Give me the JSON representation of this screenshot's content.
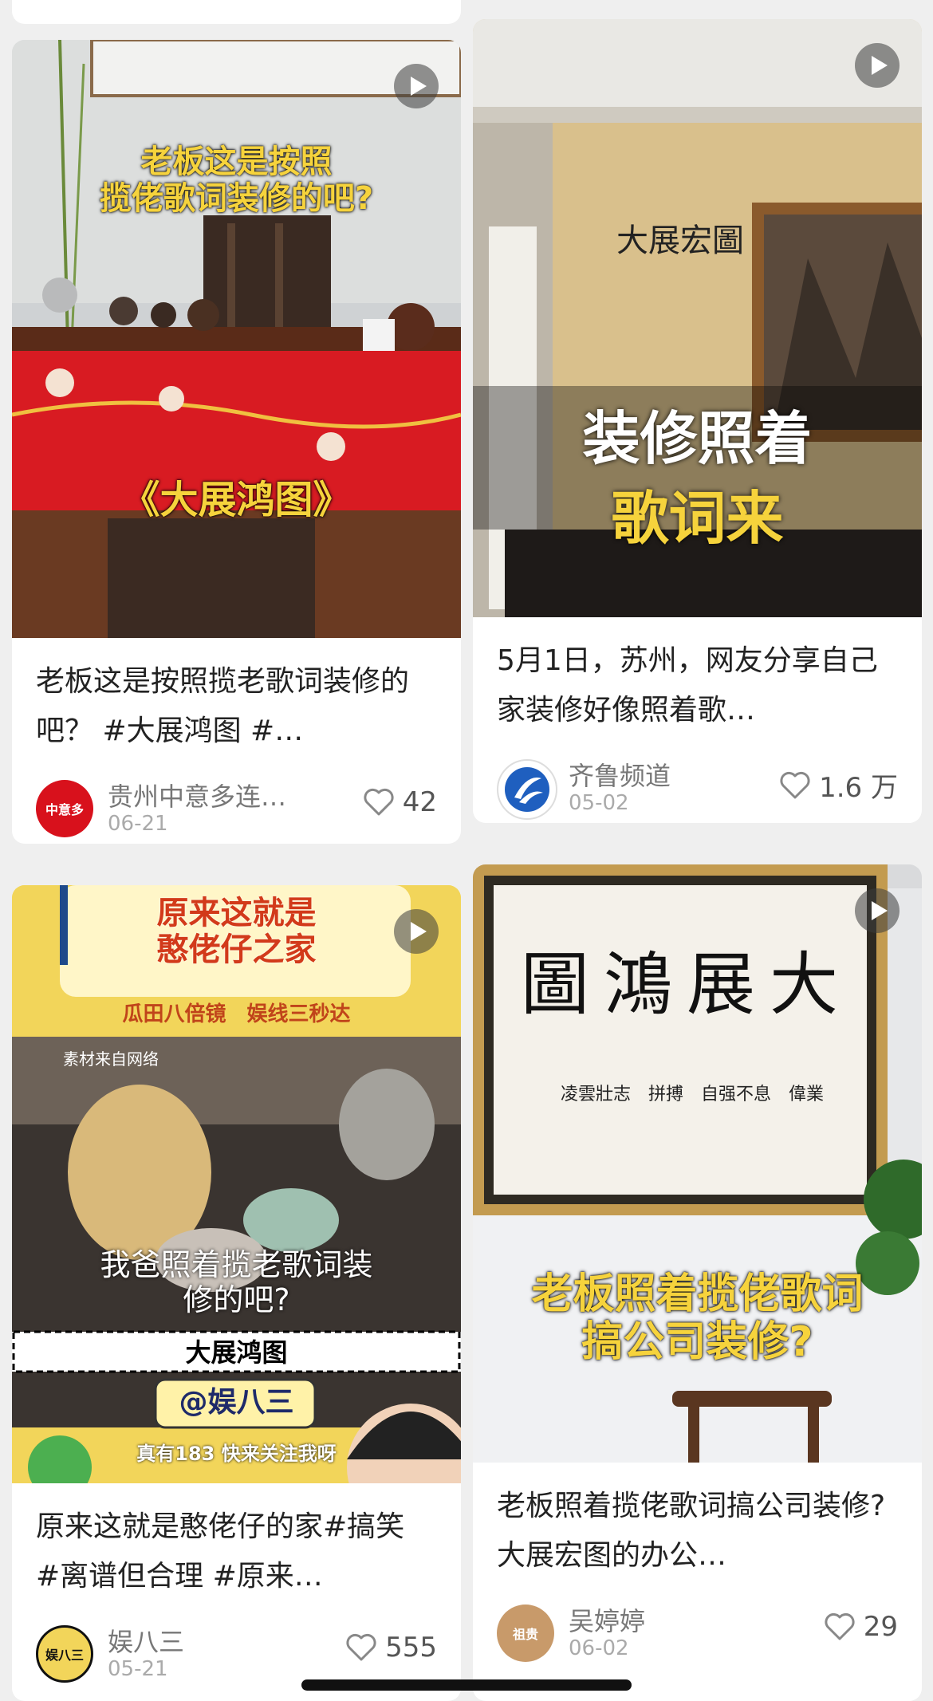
{
  "feed": [
    {
      "title": "老板这是按照揽老歌词装修的吧？ #大展鸿图 #…",
      "overlay_line1": "老板这是按照",
      "overlay_line2": "揽佬歌词装修的吧?",
      "overlay_bottom": "《大展鸿图》",
      "author": "贵州中意多连…",
      "avatar_text": "中意多",
      "date": "06-21",
      "likes": "42",
      "colors": {
        "accent": "#d8111c"
      }
    },
    {
      "title": "5月1日，苏州，网友分享自己家装修好像照着歌…",
      "overlay_line1": "装修照着",
      "overlay_line2": "歌词来",
      "wall_text": "大展宏圖",
      "author": "齐鲁频道",
      "date": "05-02",
      "likes": "1.6 万",
      "colors": {
        "accent": "#1f5fbf"
      }
    },
    {
      "title": "原来这就是憨佬仔的家#搞笑 #离谱但合理 #原来…",
      "overlay_top1": "原来这就是",
      "overlay_top2": "憨佬仔之家",
      "overlay_sub": "瓜田八倍镜　娱线三秒达",
      "watermark": "素材来自网络",
      "overlay_mid1": "我爸照着揽老歌词装",
      "overlay_mid2": "修的吧?",
      "overlay_band": "大展鸿图",
      "handle": "@娱八三",
      "overlay_footer": "真有183 快来关注我呀",
      "author": "娱八三",
      "avatar_text": "娱八三",
      "date": "05-21",
      "likes": "555",
      "colors": {
        "accent": "#f2d55a"
      }
    },
    {
      "title": "老板照着揽佬歌词搞公司装修? 大展宏图的办公…",
      "calligraphy": "大展鴻圖",
      "calligraphy_small": "凌雲壯志　拼搏　自强不息　偉業",
      "overlay_line1": "老板照着揽佬歌词",
      "overlay_line2": "搞公司装修?",
      "author": "吴婷婷",
      "avatar_text": "祖贵",
      "date": "06-02",
      "likes": "29",
      "colors": {
        "accent": "#b98a3a"
      }
    }
  ]
}
